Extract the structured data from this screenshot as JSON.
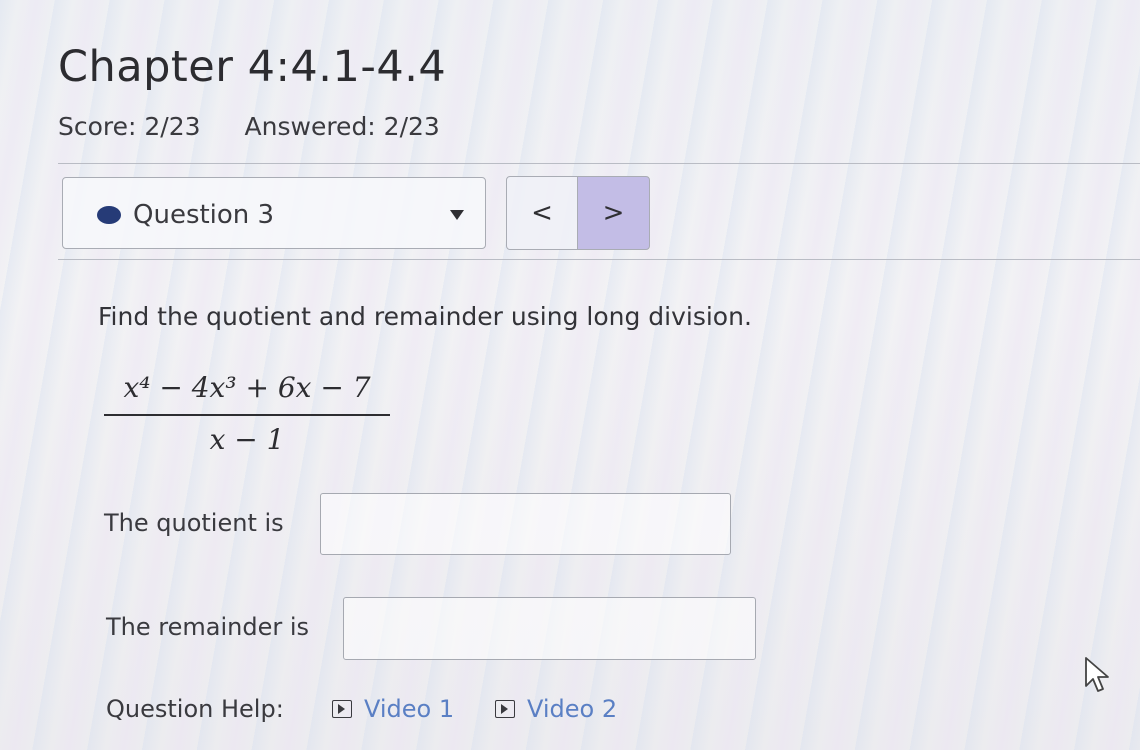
{
  "header": {
    "title": "Chapter 4:4.1-4.4",
    "score": "Score: 2/23",
    "answered": "Answered: 2/23"
  },
  "question_nav": {
    "selected": "Question 3",
    "prev_symbol": "<",
    "next_symbol": ">"
  },
  "problem": {
    "prompt": "Find the quotient and remainder using long division.",
    "numerator": "x⁴ − 4x³ + 6x − 7",
    "denominator": "x − 1"
  },
  "answers": {
    "quotient_label": "The quotient is",
    "quotient_value": "",
    "remainder_label": "The remainder is",
    "remainder_value": ""
  },
  "help": {
    "label": "Question Help:",
    "video1": "Video 1",
    "video2": "Video 2"
  },
  "colors": {
    "dot": "#263b77",
    "next_button": "#c3bde6",
    "link": "#5a7fc4"
  }
}
